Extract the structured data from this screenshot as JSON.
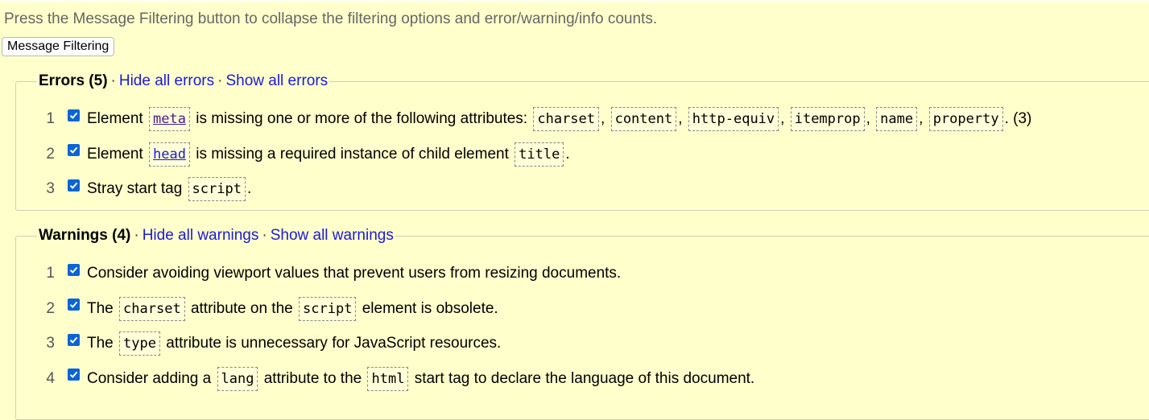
{
  "intro_text": "Press the Message Filtering button to collapse the filtering options and error/warning/info counts.",
  "filter_button_label": "Message Filtering",
  "errors": {
    "title": "Errors (5)",
    "hide_label": "Hide all errors",
    "show_label": "Show all errors",
    "items": [
      {
        "num": "1",
        "segments": [
          {
            "t": "Element "
          },
          {
            "c": "meta",
            "link": "visited"
          },
          {
            "t": " is missing one or more of the following attributes: "
          },
          {
            "c": "charset"
          },
          {
            "t": ", "
          },
          {
            "c": "content"
          },
          {
            "t": ", "
          },
          {
            "c": "http-equiv"
          },
          {
            "t": ", "
          },
          {
            "c": "itemprop"
          },
          {
            "t": ", "
          },
          {
            "c": "name"
          },
          {
            "t": ", "
          },
          {
            "c": "property"
          },
          {
            "t": ". (3)"
          }
        ]
      },
      {
        "num": "2",
        "segments": [
          {
            "t": "Element "
          },
          {
            "c": "head",
            "link": "blue"
          },
          {
            "t": " is missing a required instance of child element "
          },
          {
            "c": "title"
          },
          {
            "t": "."
          }
        ]
      },
      {
        "num": "3",
        "segments": [
          {
            "t": "Stray start tag "
          },
          {
            "c": "script"
          },
          {
            "t": "."
          }
        ]
      }
    ]
  },
  "warnings": {
    "title": "Warnings (4)",
    "hide_label": "Hide all warnings",
    "show_label": "Show all warnings",
    "items": [
      {
        "num": "1",
        "segments": [
          {
            "t": "Consider avoiding viewport values that prevent users from resizing documents."
          }
        ]
      },
      {
        "num": "2",
        "segments": [
          {
            "t": "The "
          },
          {
            "c": "charset"
          },
          {
            "t": " attribute on the "
          },
          {
            "c": "script"
          },
          {
            "t": " element is obsolete."
          }
        ]
      },
      {
        "num": "3",
        "segments": [
          {
            "t": "The "
          },
          {
            "c": "type"
          },
          {
            "t": " attribute is unnecessary for JavaScript resources."
          }
        ]
      },
      {
        "num": "4",
        "segments": [
          {
            "t": "Consider adding a "
          },
          {
            "c": "lang"
          },
          {
            "t": " attribute to the "
          },
          {
            "c": "html"
          },
          {
            "t": " start tag to declare the language of this document."
          }
        ]
      }
    ]
  }
}
